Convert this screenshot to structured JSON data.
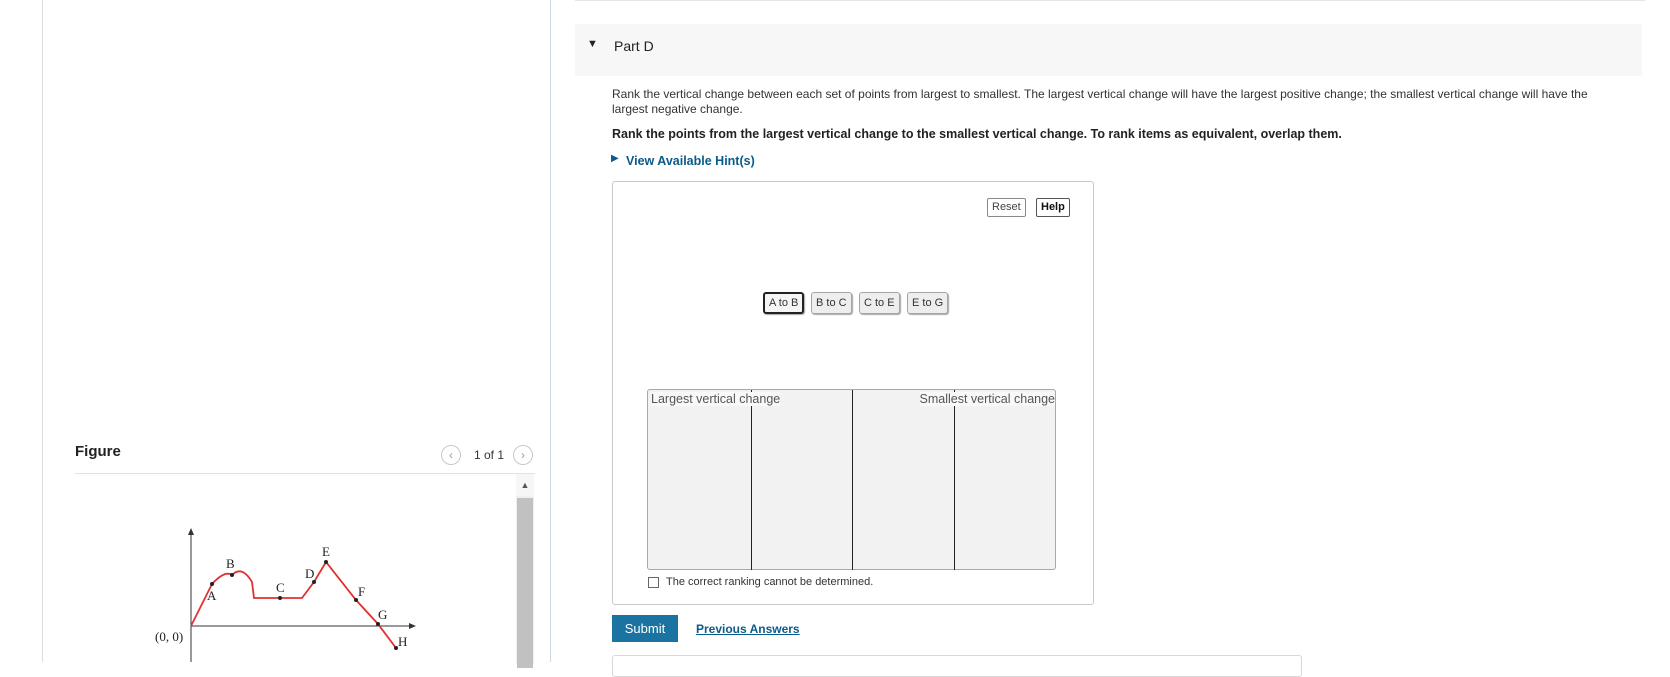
{
  "figure_panel": {
    "title": "Figure",
    "pager": "1 of 1",
    "prev_icon": "chevron-left-icon",
    "next_icon": "chevron-right-icon",
    "graph": {
      "origin_label": "(0, 0)",
      "point_labels": [
        "A",
        "B",
        "C",
        "D",
        "E",
        "F",
        "G",
        "H"
      ],
      "curve_color": "#e03030"
    }
  },
  "part": {
    "title": "Part D",
    "question": "Rank the vertical change between each set of points from largest to smallest. The largest vertical change will have the largest positive change; the smallest vertical change will have the largest negative change.",
    "instruction": "Rank the points from the largest vertical change to the smallest vertical change. To rank items as equivalent, overlap them.",
    "hint_link": "View Available Hint(s)"
  },
  "ranking": {
    "reset_label": "Reset",
    "help_label": "Help",
    "items": [
      "A to B",
      "B to C",
      "C to E",
      "E to G"
    ],
    "selected_item": "A to B",
    "largest_label": "Largest vertical change",
    "smallest_label": "Smallest vertical change",
    "cannot_determine_label": "The correct ranking cannot be determined."
  },
  "actions": {
    "submit_label": "Submit",
    "previous_answers_label": "Previous Answers"
  },
  "colors": {
    "accent": "#1a73a0",
    "link": "#0a5a8a"
  }
}
